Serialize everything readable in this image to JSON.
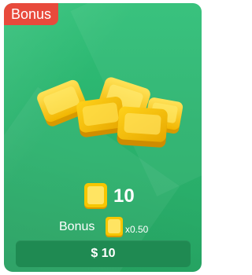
{
  "badge": {
    "label": "Bonus"
  },
  "pack": {
    "quantity": "10",
    "bonus_label": "Bonus",
    "bonus_multiplier": "x0.50",
    "price": "$ 10"
  },
  "icons": {
    "pile": "gold-tiles-pile-icon",
    "tile": "gold-tile-icon",
    "bonus_tile": "gold-tile-icon"
  },
  "colors": {
    "card_green": "#2bb36e",
    "badge_red": "#e84a3c",
    "button_green": "#1f8a52",
    "tile_gold": "#f5c400"
  }
}
